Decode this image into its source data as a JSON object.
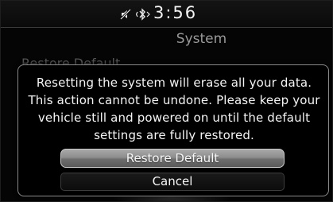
{
  "status_bar": {
    "icons": [
      "mute-icon",
      "bluetooth-icon"
    ],
    "clock": "3:56"
  },
  "header": {
    "title": "System"
  },
  "background_list": {
    "item_label": "Restore Default"
  },
  "dialog": {
    "message": "Resetting the system will erase all your data. This action cannot be undone. Please keep your vehicle still and powered on until the default settings are fully restored.",
    "restore_button_label": "Restore Default",
    "cancel_button_label": "Cancel"
  }
}
